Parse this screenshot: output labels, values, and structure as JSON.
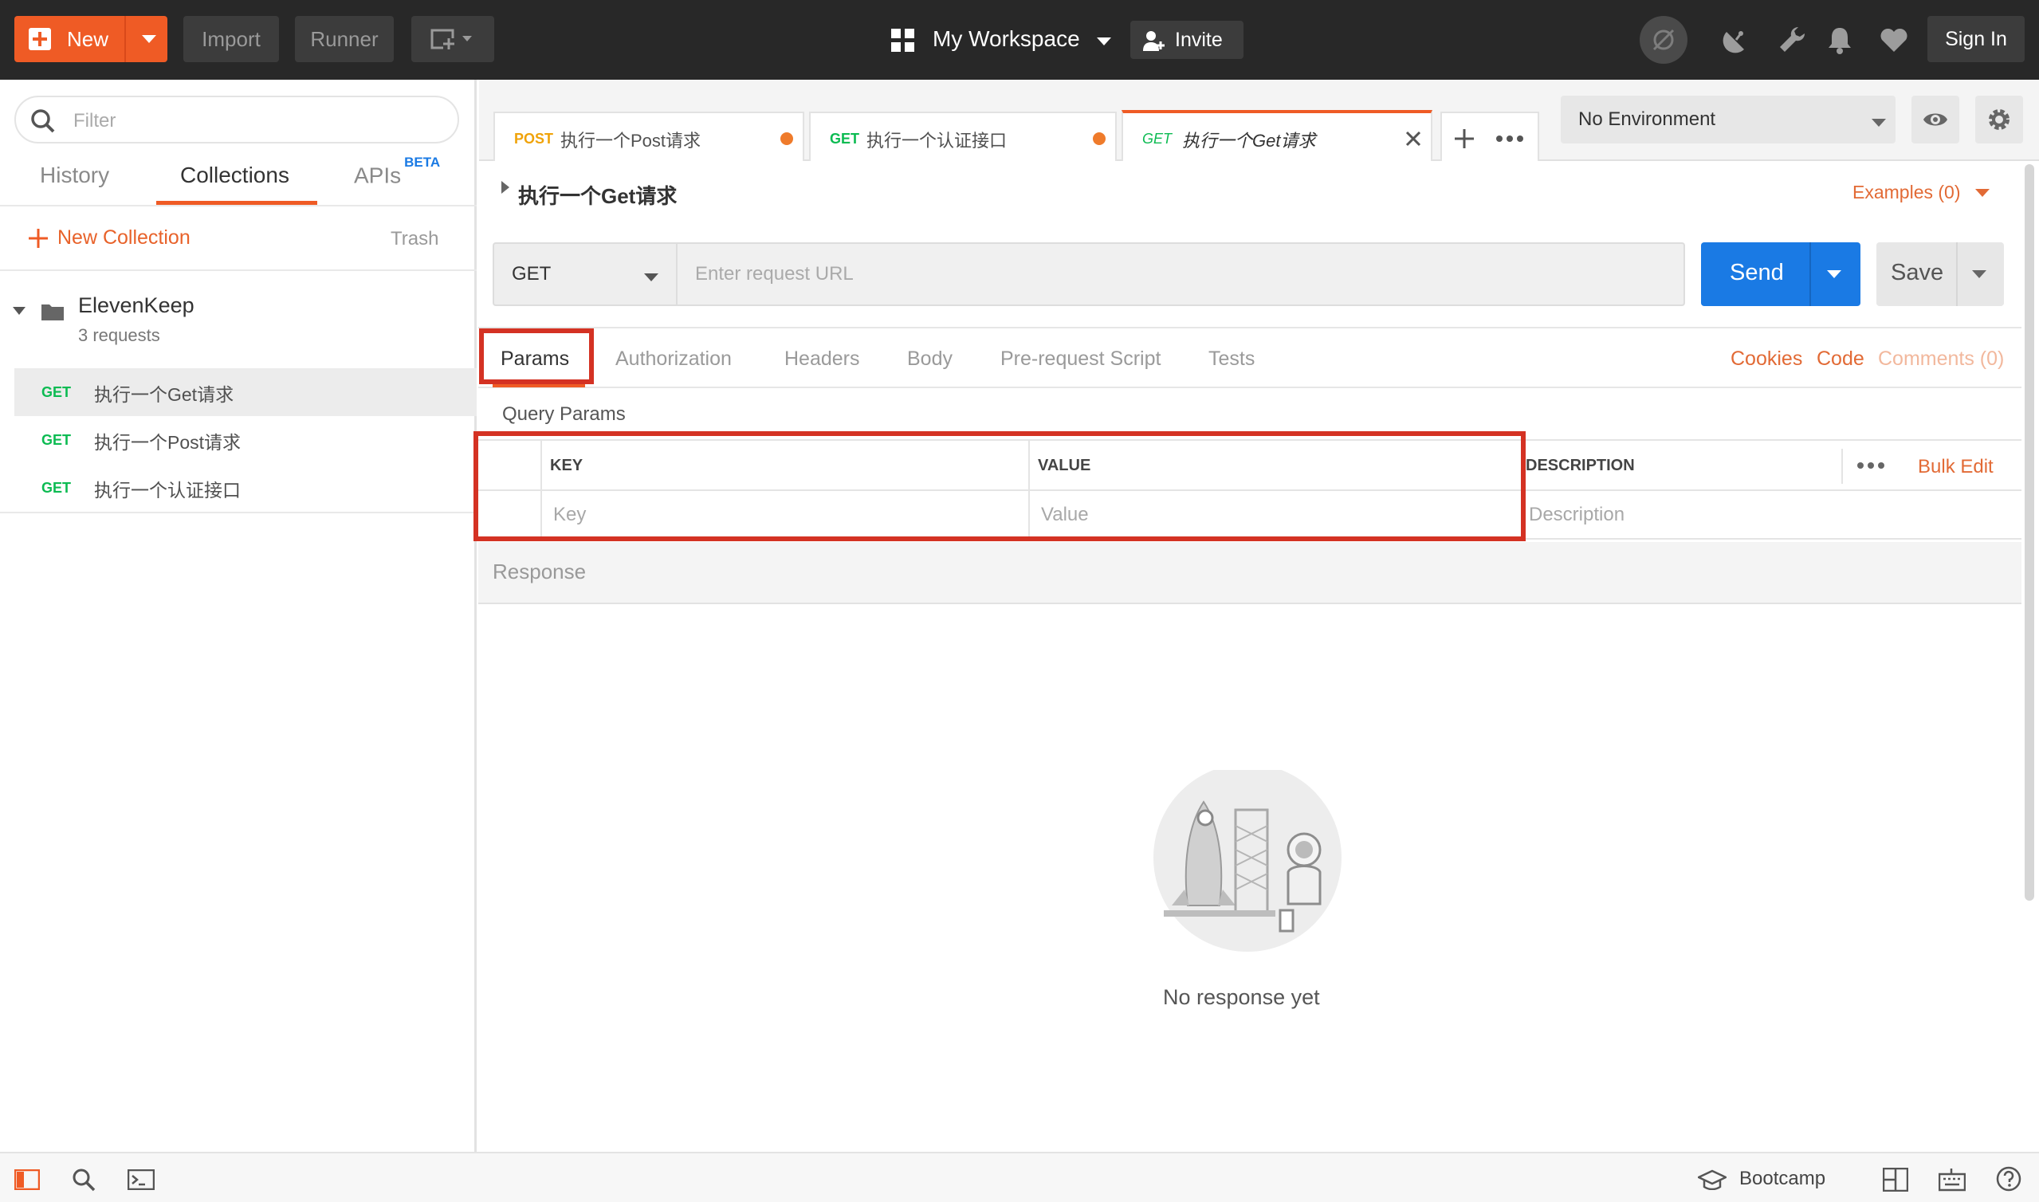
{
  "topbar": {
    "new_label": "New",
    "import_label": "Import",
    "runner_label": "Runner",
    "workspace_label": "My Workspace",
    "invite_label": "Invite",
    "signin_label": "Sign In"
  },
  "sidebar": {
    "filter_placeholder": "Filter",
    "tabs": {
      "history": "History",
      "collections": "Collections",
      "apis": "APIs",
      "apis_badge": "BETA"
    },
    "new_collection_label": "New Collection",
    "trash_label": "Trash",
    "collection": {
      "name": "ElevenKeep",
      "count": "3 requests"
    },
    "requests": [
      {
        "method": "GET",
        "name": "执行一个Get请求"
      },
      {
        "method": "GET",
        "name": "执行一个Post请求"
      },
      {
        "method": "GET",
        "name": "执行一个认证接口"
      }
    ]
  },
  "request_tabs": [
    {
      "method": "POST",
      "name": "执行一个Post请求"
    },
    {
      "method": "GET",
      "name": "执行一个认证接口"
    },
    {
      "method": "GET",
      "name": "执行一个Get请求"
    }
  ],
  "environment": {
    "selected": "No Environment"
  },
  "request": {
    "title": "执行一个Get请求",
    "examples_label": "Examples (0)",
    "method": "GET",
    "url_placeholder": "Enter request URL",
    "send_label": "Send",
    "save_label": "Save"
  },
  "subtabs": {
    "params": "Params",
    "authorization": "Authorization",
    "headers": "Headers",
    "body": "Body",
    "prerequest": "Pre-request Script",
    "tests": "Tests",
    "cookies": "Cookies",
    "code": "Code",
    "comments": "Comments (0)"
  },
  "query_params": {
    "heading": "Query Params",
    "col_key": "KEY",
    "col_value": "VALUE",
    "col_description": "DESCRIPTION",
    "bulk_edit": "Bulk Edit",
    "key_placeholder": "Key",
    "value_placeholder": "Value",
    "description_placeholder": "Description"
  },
  "response": {
    "heading": "Response",
    "empty_text": "No response yet"
  },
  "footer": {
    "bootcamp_label": "Bootcamp"
  },
  "colors": {
    "accent": "#ef5b25",
    "send_blue": "#1a7ae4",
    "get_green": "#0cbb52",
    "post_orange": "#f0a30a",
    "highlight_red": "#d43223"
  }
}
